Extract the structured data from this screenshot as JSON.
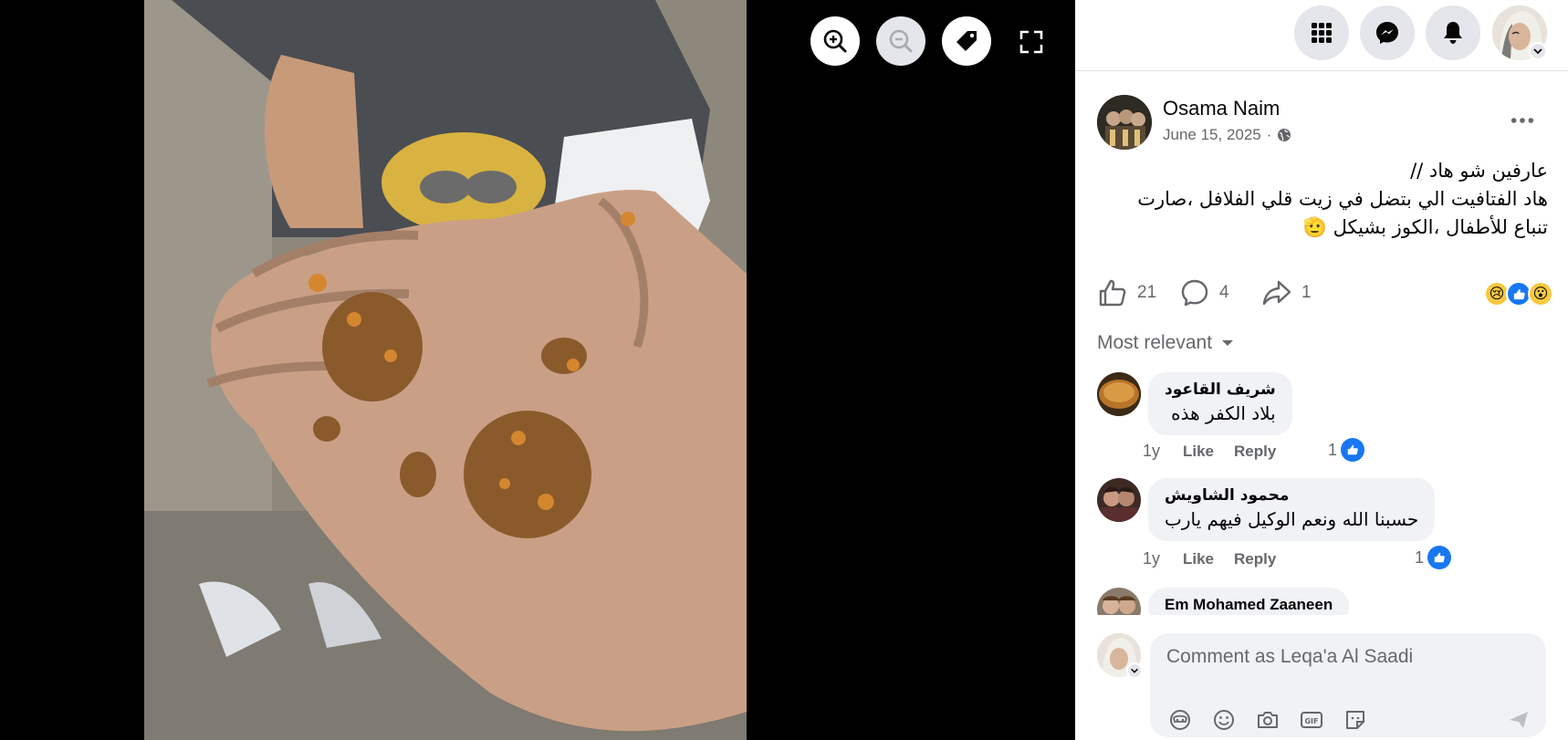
{
  "viewer": {
    "controls": [
      {
        "name": "zoom-in",
        "icon": "zoom-in-icon",
        "enabled": true
      },
      {
        "name": "zoom-out",
        "icon": "zoom-out-icon",
        "enabled": false
      },
      {
        "name": "tag",
        "icon": "tag-icon",
        "enabled": true
      },
      {
        "name": "fullscreen",
        "icon": "fullscreen-icon",
        "enabled": true
      }
    ]
  },
  "topbar": {
    "buttons": [
      "menu-grid-icon",
      "messenger-icon",
      "notifications-bell-icon"
    ],
    "profile": "account-avatar"
  },
  "post": {
    "author": "Osama Naim",
    "date": "June 15, 2025",
    "separator": "·",
    "visibility_icon": "globe-icon",
    "text_lines": [
      "عارفين شو هاد //",
      "هاد الفتافيت الي بتضل في زيت قلي الفلافل ،صارت",
      "تنباع للأطفال ،الكوز بشيكل 🫡"
    ],
    "stats": {
      "likes": "21",
      "comments": "4",
      "shares": "1"
    },
    "reactions": [
      "😢",
      "👍",
      "😮"
    ]
  },
  "sort_label": "Most relevant",
  "comments": [
    {
      "name": "شريف القاعود",
      "text": "بلاد الكفر هذه",
      "time": "1y",
      "like": "Like",
      "reply": "Reply",
      "likes": "1"
    },
    {
      "name": "محمود الشاويش",
      "text": "حسبنا الله ونعم الوكيل فيهم يارب",
      "time": "1y",
      "like": "Like",
      "reply": "Reply",
      "likes": "1"
    },
    {
      "name": "Em Mohamed Zaaneen",
      "text": "",
      "time": "",
      "like": "",
      "reply": "",
      "likes": ""
    }
  ],
  "composer": {
    "placeholder": "Comment as Leqa'a Al Saadi",
    "tools": [
      "avatar-sticker-icon",
      "emoji-icon",
      "camera-icon",
      "gif-icon",
      "sticker-icon"
    ],
    "send_icon": "send-icon"
  },
  "colors": {
    "accent": "#1877f2",
    "muted": "#65676b",
    "bubble": "#f0f2f5",
    "button_bg": "#e4e6eb"
  }
}
